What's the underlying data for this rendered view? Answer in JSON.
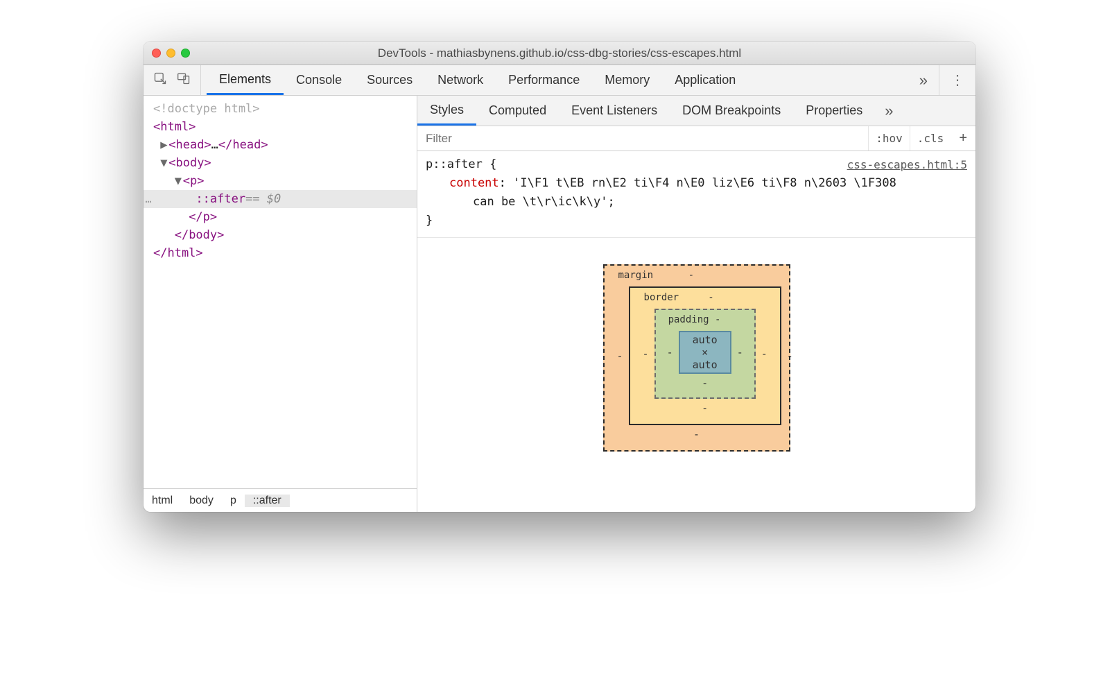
{
  "window": {
    "title": "DevTools - mathiasbynens.github.io/css-dbg-stories/css-escapes.html"
  },
  "mainTabs": {
    "items": [
      "Elements",
      "Console",
      "Sources",
      "Network",
      "Performance",
      "Memory",
      "Application"
    ],
    "active": "Elements",
    "overflow_glyph": "»",
    "kebab_glyph": "⋮"
  },
  "dom": {
    "doctype": "<!doctype html>",
    "html_open": "<html>",
    "head_collapsed_open": "<head>",
    "head_ellipsis": "…",
    "head_close": "</head>",
    "body_open": "<body>",
    "p_open": "<p>",
    "selected_pseudo": "::after",
    "selected_suffix": " == $0",
    "p_close": "</p>",
    "body_close": "</body>",
    "html_close": "</html>",
    "selected_gutter": "…"
  },
  "breadcrumbs": {
    "items": [
      "html",
      "body",
      "p",
      "::after"
    ],
    "selected": "::after"
  },
  "styleTabs": {
    "items": [
      "Styles",
      "Computed",
      "Event Listeners",
      "DOM Breakpoints",
      "Properties"
    ],
    "active": "Styles",
    "overflow_glyph": "»"
  },
  "filter": {
    "placeholder": "Filter",
    "hov": ":hov",
    "cls": ".cls",
    "plus": "+"
  },
  "rule": {
    "selector": "p::after {",
    "source": "css-escapes.html:5",
    "prop": "content",
    "colon": ": ",
    "value_line1": "'I\\F1 t\\EB rn\\E2 ti\\F4 n\\E0 liz\\E6 ti\\F8 n\\2603 \\1F308",
    "value_line2": "can be \\t\\r\\ic\\k\\y';",
    "close_brace": "}"
  },
  "boxModel": {
    "margin_label": "margin",
    "border_label": "border",
    "padding_label": "padding",
    "content": "auto × auto",
    "dash": "-"
  }
}
